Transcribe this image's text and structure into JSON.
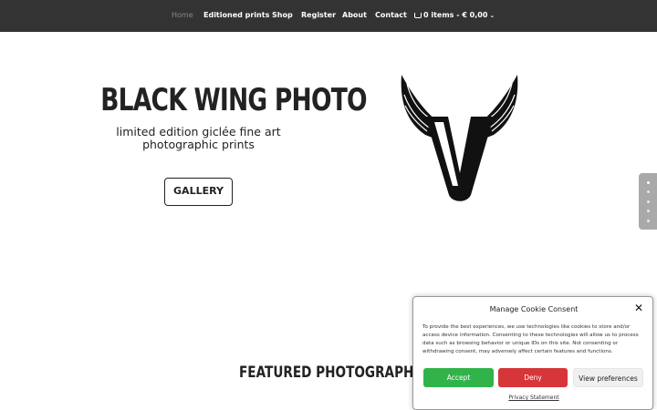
{
  "nav": {
    "items": [
      {
        "label": "Home",
        "active": true
      },
      {
        "label": "Editioned prints",
        "active": false
      },
      {
        "label": "Shop",
        "active": false
      },
      {
        "label": "Register",
        "active": false
      },
      {
        "label": "About",
        "active": false
      },
      {
        "label": "Contact",
        "active": false
      }
    ],
    "cart_label": "0 items - € 0,00",
    "cart_icon": "cart-icon"
  },
  "hero": {
    "title": "BLACK WING PHOTO",
    "subtitle": "limited edition giclée fine art photographic prints",
    "button_label": "GALLERY",
    "logo_icon": "winged-v-logo"
  },
  "side_nav": {
    "dots": 5,
    "active_index": 0
  },
  "featured": {
    "heading": "FEATURED PHOTOGRAPHIC PRINTS"
  },
  "cookie": {
    "title": "Manage Cookie Consent",
    "text": "To provide the best experiences, we use technologies like cookies to store and/or access device information. Consenting to these technologies will allow us to process data such as browsing behavior or unique IDs on this site. Not consenting or withdrawing consent, may adversely affect certain features and functions.",
    "accept_label": "Accept",
    "deny_label": "Deny",
    "preferences_label": "View preferences",
    "privacy_link": "Privacy Statement",
    "colors": {
      "accept": "#32b34a",
      "deny": "#d6353a"
    }
  }
}
